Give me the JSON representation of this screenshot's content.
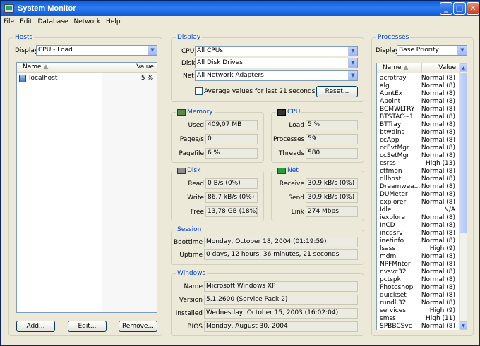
{
  "window": {
    "title": "System Monitor",
    "min": "_",
    "max": "□",
    "close": "✕"
  },
  "menu": [
    "File",
    "Edit",
    "Database",
    "Network",
    "Help"
  ],
  "hosts": {
    "title": "Hosts",
    "display_label": "Display",
    "display_value": "CPU - Load",
    "col_name": "Name",
    "col_value": "Value",
    "rows": [
      {
        "name": "localhost",
        "value": "5 %"
      }
    ],
    "add": "Add...",
    "edit": "Edit...",
    "remove": "Remove..."
  },
  "display": {
    "title": "Display",
    "cpu_label": "CPU",
    "cpu_value": "All CPUs",
    "disk_label": "Disk",
    "disk_value": "All Disk Drives",
    "net_label": "Net",
    "net_value": "All Network Adapters",
    "average_label": "Average values for last 21 seconds",
    "reset": "Reset..."
  },
  "memory": {
    "title": "Memory",
    "used_label": "Used",
    "used": "409,07 MB",
    "pages_label": "Pages/s",
    "pages": "0",
    "pagefile_label": "Pagefile",
    "pagefile": "6 %"
  },
  "cpu": {
    "title": "CPU",
    "load_label": "Load",
    "load": "5 %",
    "processes_label": "Processes",
    "processes": "59",
    "threads_label": "Threads",
    "threads": "580"
  },
  "disk": {
    "title": "Disk",
    "read_label": "Read",
    "read": "0 B/s (0%)",
    "write_label": "Write",
    "write": "86,7 kB/s (0%)",
    "free_label": "Free",
    "free": "13,78 GB (18%)"
  },
  "net": {
    "title": "Net",
    "receive_label": "Receive",
    "receive": "30,9 kB/s (0%)",
    "send_label": "Send",
    "send": "30,9 kB/s (0%)",
    "link_label": "Link",
    "link": "274 Mbps"
  },
  "session": {
    "title": "Session",
    "boottime_label": "Boottime",
    "boottime": "Monday, October 18, 2004 (01:19:59)",
    "uptime_label": "Uptime",
    "uptime": "0 days, 12 hours, 36 minutes, 21 seconds"
  },
  "windows": {
    "title": "Windows",
    "name_label": "Name",
    "name": "Microsoft Windows XP",
    "version_label": "Version",
    "version": "5.1.2600 (Service Pack 2)",
    "installed_label": "Installed",
    "installed": "Wednesday, October 15, 2003 (16:02:04)",
    "bios_label": "BIOS",
    "bios": "Monday, August 30, 2004"
  },
  "processes": {
    "title": "Processes",
    "display_label": "Display",
    "display_value": "Base Priority",
    "col_name": "Name",
    "col_value": "Value",
    "rows": [
      {
        "name": "acrotray",
        "value": "Normal (8)"
      },
      {
        "name": "alg",
        "value": "Normal (8)"
      },
      {
        "name": "ApntEx",
        "value": "Normal (8)"
      },
      {
        "name": "Apoint",
        "value": "Normal (8)"
      },
      {
        "name": "BCMWLTRY",
        "value": "Normal (8)"
      },
      {
        "name": "BTSTAC~1",
        "value": "Normal (8)"
      },
      {
        "name": "BTTray",
        "value": "Normal (8)"
      },
      {
        "name": "btwdins",
        "value": "Normal (8)"
      },
      {
        "name": "ccApp",
        "value": "Normal (8)"
      },
      {
        "name": "ccEvtMgr",
        "value": "Normal (8)"
      },
      {
        "name": "ccSetMgr",
        "value": "Normal (8)"
      },
      {
        "name": "csrss",
        "value": "High (13)"
      },
      {
        "name": "ctfmon",
        "value": "Normal (8)"
      },
      {
        "name": "dllhost",
        "value": "Normal (8)"
      },
      {
        "name": "Dreamwea...",
        "value": "Normal (8)"
      },
      {
        "name": "DUMeter",
        "value": "Normal (8)"
      },
      {
        "name": "explorer",
        "value": "Normal (8)"
      },
      {
        "name": "Idle",
        "value": "N/A"
      },
      {
        "name": "iexplore",
        "value": "Normal (8)"
      },
      {
        "name": "InCD",
        "value": "Normal (8)"
      },
      {
        "name": "incdsrv",
        "value": "Normal (8)"
      },
      {
        "name": "inetinfo",
        "value": "Normal (8)"
      },
      {
        "name": "lsass",
        "value": "High (9)"
      },
      {
        "name": "mdm",
        "value": "Normal (8)"
      },
      {
        "name": "NPFMntor",
        "value": "Normal (8)"
      },
      {
        "name": "nvsvc32",
        "value": "Normal (8)"
      },
      {
        "name": "pctspk",
        "value": "Normal (8)"
      },
      {
        "name": "Photoshop",
        "value": "Normal (8)"
      },
      {
        "name": "quickset",
        "value": "Normal (8)"
      },
      {
        "name": "rundll32",
        "value": "Normal (8)"
      },
      {
        "name": "services",
        "value": "High (9)"
      },
      {
        "name": "smss",
        "value": "High (11)"
      },
      {
        "name": "SPBBCSvc",
        "value": "Normal (8)"
      }
    ]
  }
}
